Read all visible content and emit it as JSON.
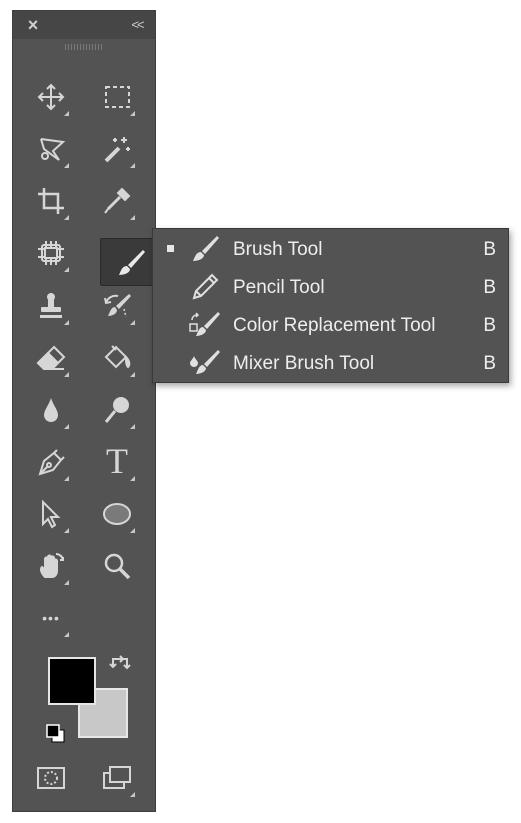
{
  "panel": {
    "close_icon": "×",
    "collapse_icon": "<<",
    "tools": [
      {
        "name": "move-tool",
        "icon": "move-icon"
      },
      {
        "name": "rectangular-marquee-tool",
        "icon": "marquee-icon"
      },
      {
        "name": "lasso-tool",
        "icon": "polygonal-lasso-icon"
      },
      {
        "name": "magic-wand-tool",
        "icon": "magic-wand-icon"
      },
      {
        "name": "crop-tool",
        "icon": "crop-icon"
      },
      {
        "name": "eyedropper-tool",
        "icon": "eyedropper-icon"
      },
      {
        "name": "spot-healing-tool",
        "icon": "healing-patch-icon"
      },
      {
        "name": "brush-tool",
        "icon": "brush-icon",
        "active": true
      },
      {
        "name": "clone-stamp-tool",
        "icon": "stamp-icon"
      },
      {
        "name": "history-brush-tool",
        "icon": "history-brush-icon"
      },
      {
        "name": "eraser-tool",
        "icon": "eraser-icon"
      },
      {
        "name": "paint-bucket-tool",
        "icon": "paint-bucket-icon"
      },
      {
        "name": "blur-tool",
        "icon": "drop-icon"
      },
      {
        "name": "dodge-tool",
        "icon": "dodge-icon"
      },
      {
        "name": "pen-tool",
        "icon": "pen-icon"
      },
      {
        "name": "type-tool",
        "icon": "type-icon",
        "glyph": "T"
      },
      {
        "name": "path-selection-tool",
        "icon": "arrow-icon"
      },
      {
        "name": "ellipse-tool",
        "icon": "ellipse-icon"
      },
      {
        "name": "hand-tool",
        "icon": "hand-icon"
      },
      {
        "name": "zoom-tool",
        "icon": "magnifier-icon"
      },
      {
        "name": "edit-toolbar",
        "icon": "ellipsis-icon",
        "glyph": "•••"
      }
    ],
    "foreground_color": "#000000",
    "background_color": "#c8c8c8"
  },
  "flyout": {
    "items": [
      {
        "label": "Brush Tool",
        "shortcut": "B",
        "icon": "brush-icon",
        "selected": true
      },
      {
        "label": "Pencil Tool",
        "shortcut": "B",
        "icon": "pencil-icon",
        "selected": false
      },
      {
        "label": "Color Replacement Tool",
        "shortcut": "B",
        "icon": "color-replacement-icon",
        "selected": false
      },
      {
        "label": "Mixer Brush Tool",
        "shortcut": "B",
        "icon": "mixer-brush-icon",
        "selected": false
      }
    ]
  }
}
